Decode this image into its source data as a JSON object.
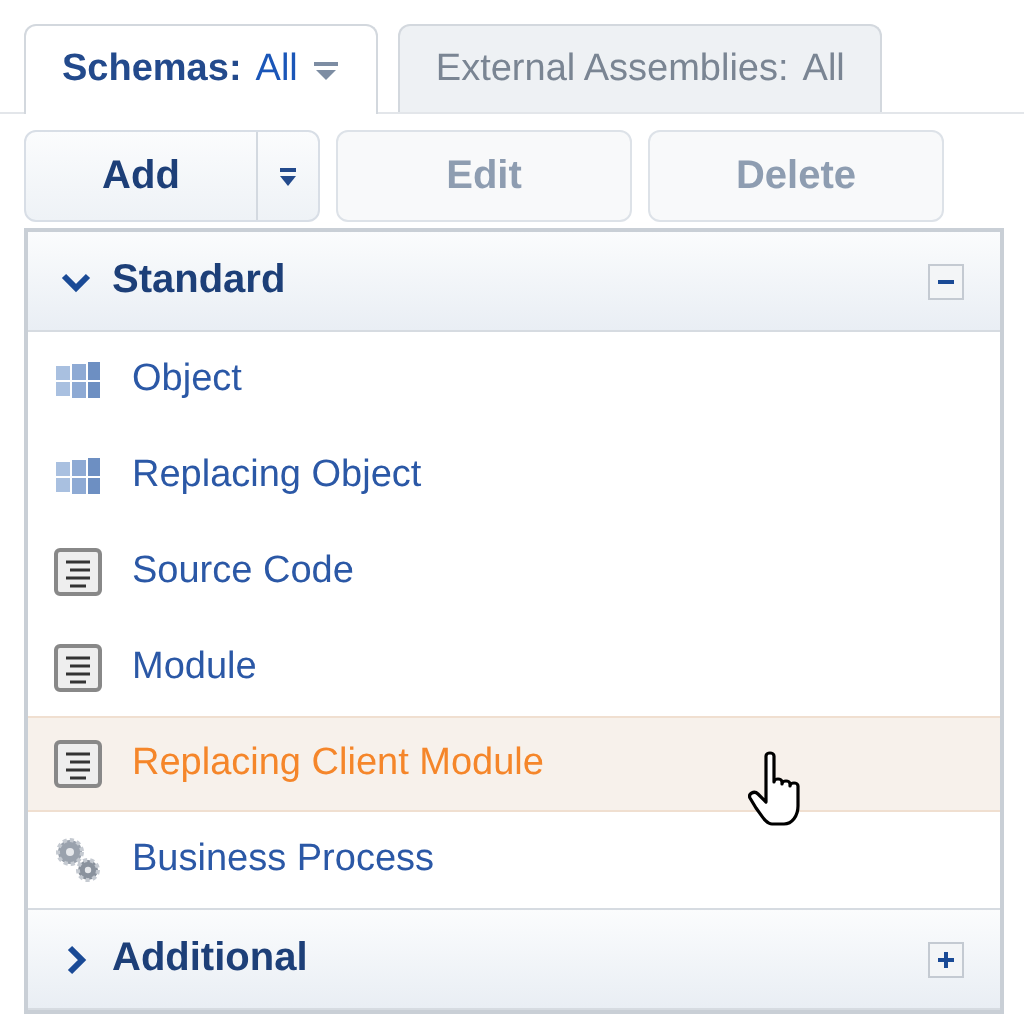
{
  "tabs": [
    {
      "label": "Schemas:",
      "value": "All",
      "has_menu": true,
      "selected": true
    },
    {
      "label": "External Assemblies:",
      "value": "All",
      "has_menu": false,
      "selected": false
    }
  ],
  "toolbar": [
    {
      "label": "Add",
      "split": true,
      "disabled": false
    },
    {
      "label": "Edit",
      "split": false,
      "disabled": true
    },
    {
      "label": "Delete",
      "split": false,
      "disabled": true
    }
  ],
  "menu_groups": [
    {
      "title": "Standard",
      "expanded": true,
      "items": [
        {
          "label": "Object",
          "kind": "cube",
          "hovered": false
        },
        {
          "label": "Replacing Object",
          "kind": "cube",
          "hovered": false
        },
        {
          "label": "Source Code",
          "kind": "document",
          "hovered": false
        },
        {
          "label": "Module",
          "kind": "document",
          "hovered": false
        },
        {
          "label": "Replacing Client Module",
          "kind": "document",
          "hovered": true
        },
        {
          "label": "Business Process",
          "kind": "gears",
          "hovered": false
        }
      ]
    },
    {
      "title": "Additional",
      "expanded": false
    }
  ]
}
